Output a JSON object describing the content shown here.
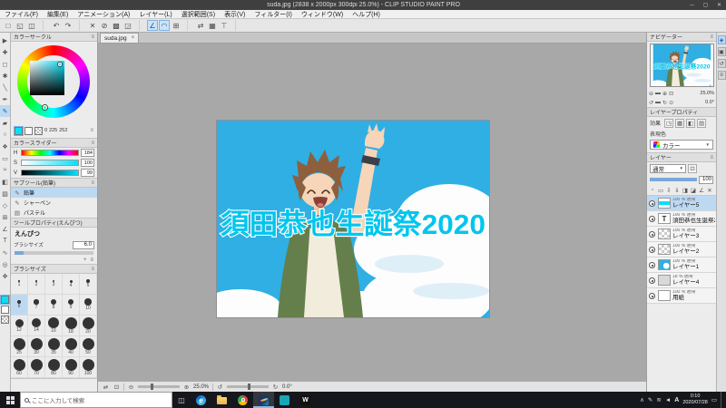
{
  "colors": {
    "accent": "#7FB2E5",
    "selection": "#BDD9F2",
    "main-color": "#00E1FC",
    "sky": "#2FAFE3",
    "art-text": "#00C6EE",
    "hair": "#8E5F3C",
    "jacket": "#647F4B",
    "taskbar": "#15171C",
    "panel": "#ECECEC"
  },
  "icons": {
    "minimize": "─",
    "maximize": "▢",
    "close": "✕",
    "close-tab": "×",
    "chevron-down": "▼",
    "menu": "≡",
    "zoom-out": "⊖",
    "zoom-in": "⊕",
    "fit-window": "⊡",
    "rotate-ccw": "↺",
    "rotate-cw": "↻",
    "flip-horizontal": "⇄",
    "crosshair": "+",
    "task-view": "◫",
    "action-center": "▭",
    "plus": "+",
    "wrench": "✚"
  },
  "window": {
    "title": "suda.jpg (2838 x 2000px 300dpi 25.0%) - CLIP STUDIO PAINT PRO"
  },
  "menubar": {
    "items": [
      {
        "name": "file",
        "label": "ファイル(F)"
      },
      {
        "name": "edit",
        "label": "編集(E)"
      },
      {
        "name": "animation",
        "label": "アニメーション(A)"
      },
      {
        "name": "layer",
        "label": "レイヤー(L)"
      },
      {
        "name": "select",
        "label": "選択範囲(S)"
      },
      {
        "name": "view",
        "label": "表示(V)"
      },
      {
        "name": "filter",
        "label": "フィルター(I)"
      },
      {
        "name": "window",
        "label": "ウィンドウ(W)"
      },
      {
        "name": "help",
        "label": "ヘルプ(H)"
      }
    ]
  },
  "toolbar": {
    "groups": [
      {
        "items": [
          {
            "name": "new-file",
            "glyph": "□"
          },
          {
            "name": "open-file",
            "glyph": "◱"
          },
          {
            "name": "save-file",
            "glyph": "◫"
          }
        ]
      },
      {
        "items": [
          {
            "name": "undo",
            "glyph": "↶"
          },
          {
            "name": "redo",
            "glyph": "↷"
          }
        ]
      },
      {
        "items": [
          {
            "name": "delete",
            "glyph": "✕"
          },
          {
            "name": "delete-outside-selection",
            "glyph": "⊘"
          },
          {
            "name": "fill",
            "glyph": "▩"
          },
          {
            "name": "scale-rotate",
            "glyph": "◲"
          }
        ]
      },
      {
        "items": [
          {
            "name": "snap-to-ruler",
            "glyph": "∠",
            "active": true
          },
          {
            "name": "snap-to-special-ruler",
            "glyph": "◠",
            "active": true
          },
          {
            "name": "snap-to-grid",
            "glyph": "⊞"
          }
        ]
      },
      {
        "items": [
          {
            "name": "flip-horizontal",
            "glyph": "⇄"
          },
          {
            "name": "show-grid",
            "glyph": "▦"
          },
          {
            "name": "show-ruler",
            "glyph": "⊤"
          }
        ]
      }
    ]
  },
  "tabbar": {
    "tabs": [
      {
        "label": "suda.jpg"
      }
    ]
  },
  "toolstrip": {
    "tools": [
      {
        "name": "operation-tool",
        "glyph": "▶"
      },
      {
        "name": "layer-move-tool",
        "glyph": "✚"
      },
      {
        "name": "selection-area-tool",
        "glyph": "◻"
      },
      {
        "name": "auto-select-tool",
        "glyph": "✱"
      },
      {
        "name": "eyedropper-tool",
        "glyph": "╲"
      },
      {
        "name": "pen-tool",
        "glyph": "✒"
      },
      {
        "name": "pencil-tool",
        "glyph": "✎",
        "selected": true
      },
      {
        "name": "brush-tool",
        "glyph": "▰"
      },
      {
        "name": "airbrush-tool",
        "glyph": "○"
      },
      {
        "name": "decoration-tool",
        "glyph": "❖"
      },
      {
        "name": "eraser-tool",
        "glyph": "▭"
      },
      {
        "name": "blend-tool",
        "glyph": "≈"
      },
      {
        "name": "fill-tool",
        "glyph": "◧"
      },
      {
        "name": "gradient-tool",
        "glyph": "▨"
      },
      {
        "name": "figure-tool",
        "glyph": "◇"
      },
      {
        "name": "frame-border-tool",
        "glyph": "⊞"
      },
      {
        "name": "ruler-tool",
        "glyph": "∠"
      },
      {
        "name": "text-tool",
        "glyph": "T"
      },
      {
        "name": "line-correction-tool",
        "glyph": "∿"
      },
      {
        "name": "zoom-tool",
        "glyph": "◎"
      },
      {
        "name": "move-tool",
        "glyph": "✥"
      }
    ]
  },
  "color_wheel": {
    "title": "カラーサークル",
    "readout": [
      "0",
      "225",
      "252"
    ]
  },
  "color_slider": {
    "title": "カラースライダー",
    "sliders": [
      {
        "label": "H",
        "value": "184"
      },
      {
        "label": "S",
        "value": "100"
      },
      {
        "label": "V",
        "value": "99"
      }
    ]
  },
  "subtool": {
    "title": "サブツール(鉛筆)",
    "items": [
      {
        "name": "pencil",
        "label": "鉛筆",
        "glyph": "✎",
        "selected": true
      },
      {
        "name": "mechanical-pencil",
        "label": "シャーペン",
        "glyph": "✎"
      },
      {
        "name": "pastel",
        "label": "パステル",
        "glyph": "▤"
      }
    ]
  },
  "tool_property": {
    "title": "ツールプロパティ(えんぴつ)",
    "tool_name": "えんぴつ",
    "brush_size_label": "ブラシサイズ",
    "brush_size_value": "6.0"
  },
  "brush_size_panel": {
    "title": "ブラシサイズ",
    "sizes": [
      1,
      2,
      3,
      4,
      5,
      6,
      7,
      8,
      9,
      10,
      12,
      14,
      16,
      18,
      20,
      25,
      30,
      35,
      40,
      50,
      60,
      70,
      80,
      90,
      100
    ],
    "selected": 6
  },
  "canvas": {
    "artwork_text": "須田恭也生誕祭2020",
    "status": {
      "zoom": "25.0%",
      "rotation": "0.0°"
    }
  },
  "navigator": {
    "title": "ナビゲーター",
    "zoom_value": "25.0%",
    "rotate_value": "0.0°",
    "zoom_icons": [
      {
        "name": "nav-zoom-out-icon",
        "glyph": "⊖"
      },
      {
        "name": "nav-zoom-slider",
        "glyph": "▬"
      },
      {
        "name": "nav-zoom-in-icon",
        "glyph": "⊕"
      },
      {
        "name": "nav-fit-window-icon",
        "glyph": "⊡"
      }
    ],
    "rotate_icons": [
      {
        "name": "nav-rotate-ccw-icon",
        "glyph": "↺"
      },
      {
        "name": "nav-rotate-slider",
        "glyph": "▬"
      },
      {
        "name": "nav-rotate-cw-icon",
        "glyph": "↻"
      },
      {
        "name": "nav-reset-rotate-icon",
        "glyph": "⊙"
      }
    ]
  },
  "layer_property": {
    "title": "レイヤープロパティ",
    "effect_label": "効果",
    "effects": [
      {
        "name": "border-effect-icon",
        "glyph": "◳"
      },
      {
        "name": "tone-effect-icon",
        "glyph": "▦"
      },
      {
        "name": "layer-color-icon",
        "glyph": "◧"
      },
      {
        "name": "paper-texture-icon",
        "glyph": "▤"
      }
    ],
    "expression_label": "表現色",
    "expression_value": "カラー"
  },
  "layer_panel": {
    "title": "レイヤー",
    "blend_mode": "通常",
    "opacity": "100",
    "commands": [
      {
        "name": "new-raster-layer-icon",
        "glyph": "▫"
      },
      {
        "name": "new-layer-folder-icon",
        "glyph": "▭"
      },
      {
        "name": "transfer-down-icon",
        "glyph": "⇩"
      },
      {
        "name": "merge-down-icon",
        "glyph": "⇓"
      },
      {
        "name": "create-mask-icon",
        "glyph": "◨"
      },
      {
        "name": "apply-mask-icon",
        "glyph": "◪"
      },
      {
        "name": "layer-ruler-icon",
        "glyph": "∠"
      },
      {
        "name": "delete-layer-icon",
        "glyph": "✕"
      }
    ],
    "layers": [
      {
        "opacity": "100 %",
        "mode": "通常",
        "name": "レイヤー5",
        "thumb": "cyantext",
        "selected": true
      },
      {
        "opacity": "100 %",
        "mode": "通常",
        "name": "須田恭也生誕祭2020",
        "thumb": "text",
        "thumb_label": "T"
      },
      {
        "opacity": "100 %",
        "mode": "通常",
        "name": "レイヤー3",
        "thumb": "checker"
      },
      {
        "opacity": "100 %",
        "mode": "通常",
        "name": "レイヤー2",
        "thumb": "checker"
      },
      {
        "opacity": "100 %",
        "mode": "通常",
        "name": "レイヤー1",
        "thumb": "art"
      },
      {
        "opacity": "18 %",
        "mode": "通常",
        "name": "レイヤー4",
        "thumb": "gray"
      },
      {
        "opacity": "100 %",
        "mode": "通常",
        "name": "用紙",
        "thumb": "paper"
      }
    ]
  },
  "right_strip": [
    {
      "name": "quick-access-palette-icon",
      "glyph": "◈",
      "active": true
    },
    {
      "name": "material-palette-icon",
      "glyph": "▣"
    },
    {
      "name": "history-palette-icon",
      "glyph": "↺"
    },
    {
      "name": "information-palette-icon",
      "glyph": "≡"
    }
  ],
  "taskbar": {
    "search_placeholder": "ここに入力して検索",
    "apps": [
      {
        "name": "edge",
        "kind": "edge",
        "glyph": "e"
      },
      {
        "name": "file-explorer",
        "kind": "folder",
        "glyph": ""
      },
      {
        "name": "chrome",
        "kind": "chrome",
        "glyph": ""
      },
      {
        "name": "clip-studio-paint",
        "kind": "csp",
        "glyph": "",
        "active": true
      },
      {
        "name": "clip-studio",
        "kind": "cs",
        "glyph": ""
      },
      {
        "name": "wacom",
        "kind": "w",
        "glyph": "W"
      }
    ],
    "tray": {
      "icons": [
        {
          "name": "hidden-icons-chevron",
          "glyph": "∧"
        },
        {
          "name": "pen-tablet-icon",
          "glyph": "✎"
        },
        {
          "name": "network-icon",
          "glyph": "≋"
        },
        {
          "name": "volume-icon",
          "glyph": "◄"
        }
      ],
      "ime": "A",
      "time": "0:10",
      "date": "2020/07/28"
    }
  }
}
